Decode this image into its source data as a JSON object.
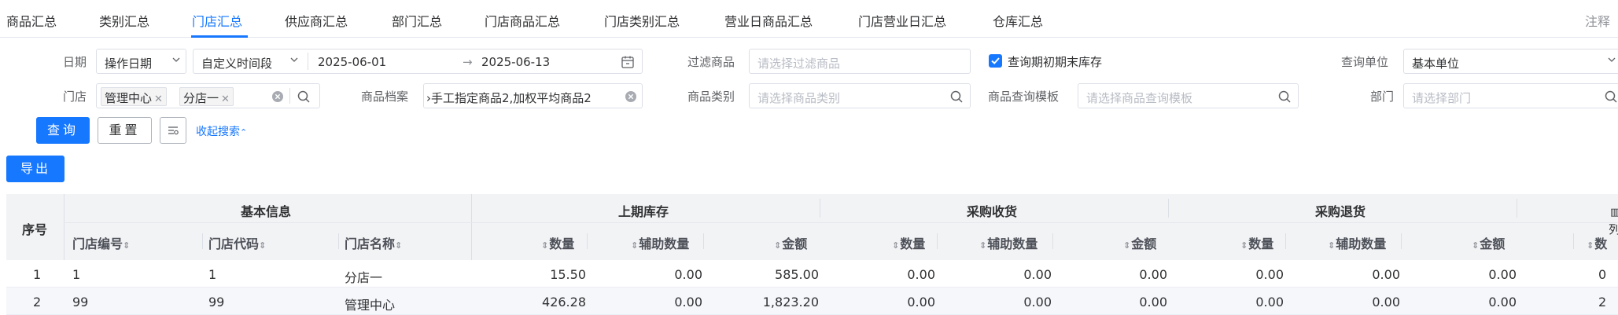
{
  "tabs": [
    {
      "label": "商品汇总",
      "active": false
    },
    {
      "label": "类别汇总",
      "active": false
    },
    {
      "label": "门店汇总",
      "active": true
    },
    {
      "label": "供应商汇总",
      "active": false
    },
    {
      "label": "部门汇总",
      "active": false
    },
    {
      "label": "门店商品汇总",
      "active": false
    },
    {
      "label": "门店类别汇总",
      "active": false
    },
    {
      "label": "营业日商品汇总",
      "active": false
    },
    {
      "label": "门店营业日汇总",
      "active": false
    },
    {
      "label": "仓库汇总",
      "active": false
    }
  ],
  "note_label": "注释",
  "filters": {
    "date_label": "日期",
    "date_type": "操作日期",
    "range_type": "自定义时间段",
    "start_date": "2025-06-01",
    "range_sep": "→",
    "end_date": "2025-06-13",
    "filter_goods_label": "过滤商品",
    "filter_goods_placeholder": "请选择过滤商品",
    "checkbox_label": "查询期初期末库存",
    "checkbox_checked": true,
    "unit_label": "查询单位",
    "unit_value": "基本单位",
    "store_label": "门店",
    "store_tags": [
      "管理中心",
      "分店一"
    ],
    "goods_archive_label": "商品档案",
    "goods_archive_value": "›手工指定商品2,加权平均商品2",
    "category_label": "商品类别",
    "category_placeholder": "请选择商品类别",
    "template_label": "商品查询模板",
    "template_placeholder": "请选择商品查询模板",
    "dept_label": "部门",
    "dept_placeholder": "请选择部门"
  },
  "buttons": {
    "query": "查询",
    "reset": "重置",
    "collapse": "收起搜索",
    "export": "导出"
  },
  "table": {
    "index_header": "序号",
    "groups": [
      "基本信息",
      "上期库存",
      "采购收货",
      "采购退货"
    ],
    "basic_columns": [
      "门店编号",
      "门店代码",
      "门店名称"
    ],
    "metric_columns": [
      "数量",
      "辅助数量",
      "金额"
    ],
    "cut_column": "数",
    "side_label": "列",
    "rows": [
      {
        "index": "1",
        "store_no": "1",
        "store_code": "1",
        "store_name": "分店一",
        "values": [
          "15.50",
          "0.00",
          "585.00",
          "0.00",
          "0.00",
          "0.00",
          "0.00",
          "0.00",
          "0.00"
        ],
        "cut": "0"
      },
      {
        "index": "2",
        "store_no": "99",
        "store_code": "99",
        "store_name": "管理中心",
        "values": [
          "426.28",
          "0.00",
          "1,823.20",
          "0.00",
          "0.00",
          "0.00",
          "0.00",
          "0.00",
          "0.00"
        ],
        "cut": "2"
      }
    ]
  },
  "colors": {
    "accent": "#1677ff",
    "header_bg": "#f2f3f5",
    "border": "#dcdfe6"
  }
}
